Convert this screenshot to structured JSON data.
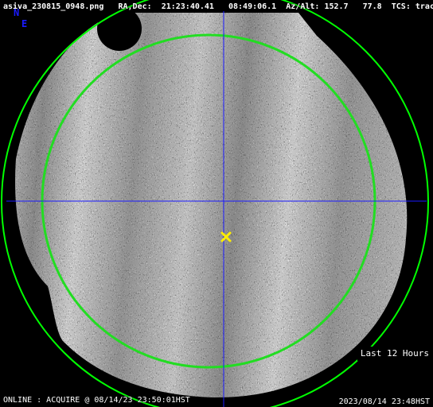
{
  "header": {
    "filename": "asiva_230815_0948.png",
    "radec_label": "RA,Dec:",
    "ra": "21:23:40.41",
    "dec": "08:49:06.1",
    "azalt_label": "Az/Alt:",
    "az": "152.7",
    "alt": "77.8",
    "tcs_label": "TCS:",
    "tcs_state": "track"
  },
  "compass": {
    "north": "N",
    "east": "E"
  },
  "overlay": {
    "time_window_label": "Last 12 Hours"
  },
  "footer": {
    "status": "ONLINE : ACQUIRE @ 08/14/23 23:50:01HST",
    "timestamp": "2023/08/14 23:48HST"
  },
  "colors": {
    "background": "#000000",
    "horizon_circle": "#00ff00",
    "altitude_circle": "#22dd22",
    "crosshair": "#1a1aff",
    "target_marker": "#ffee00",
    "text": "#ffffff"
  },
  "icons": {
    "target_marker": "x-marker-icon"
  }
}
